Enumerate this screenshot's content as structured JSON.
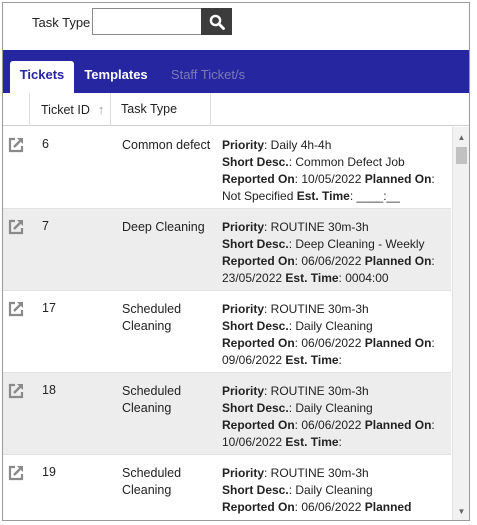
{
  "search": {
    "label": "Task Type",
    "value": "",
    "placeholder": ""
  },
  "tabs": [
    {
      "label": "Tickets",
      "state": "active"
    },
    {
      "label": "Templates",
      "state": "normal"
    },
    {
      "label": "Staff Ticket/s",
      "state": "disabled"
    }
  ],
  "table": {
    "columns": {
      "ticket_id": "Ticket ID",
      "task_type": "Task Type"
    },
    "sort_indicator": "↑",
    "rows": [
      {
        "id": "6",
        "task_type": "Common defect",
        "priority_label": "Priority",
        "priority": ": Daily 4h-4h",
        "short_desc_label": "Short Desc.",
        "short_desc": ": Common Defect Job",
        "reported_label": "Reported On",
        "reported": ": 10/05/2022 ",
        "planned_label": "Planned On",
        "planned": ": Not Specified ",
        "est_label": "Est. Time",
        "est": ": ____:__"
      },
      {
        "id": "7",
        "task_type": "Deep Cleaning",
        "priority_label": "Priority",
        "priority": ": ROUTINE 30m-3h",
        "short_desc_label": "Short Desc.",
        "short_desc": ": Deep Cleaning - Weekly",
        "reported_label": "Reported On",
        "reported": ": 06/06/2022 ",
        "planned_label": "Planned On",
        "planned": ": 23/05/2022 ",
        "est_label": "Est. Time",
        "est": ": 0004:00"
      },
      {
        "id": "17",
        "task_type": "Scheduled Cleaning",
        "priority_label": "Priority",
        "priority": ": ROUTINE 30m-3h",
        "short_desc_label": "Short Desc.",
        "short_desc": ": Daily Cleaning",
        "reported_label": "Reported On",
        "reported": ": 06/06/2022 ",
        "planned_label": "Planned On",
        "planned": ": 09/06/2022 ",
        "est_label": "Est. Time",
        "est": ":"
      },
      {
        "id": "18",
        "task_type": "Scheduled Cleaning",
        "priority_label": "Priority",
        "priority": ": ROUTINE 30m-3h",
        "short_desc_label": "Short Desc.",
        "short_desc": ": Daily Cleaning",
        "reported_label": "Reported On",
        "reported": ": 06/06/2022 ",
        "planned_label": "Planned On",
        "planned": ": 10/06/2022 ",
        "est_label": "Est. Time",
        "est": ":"
      },
      {
        "id": "19",
        "task_type": "Scheduled Cleaning",
        "priority_label": "Priority",
        "priority": ": ROUTINE 30m-3h",
        "short_desc_label": "Short Desc.",
        "short_desc": ": Daily Cleaning",
        "reported_label": "Reported On",
        "reported": ": 06/06/2022 ",
        "planned_label": "Planned",
        "planned": "",
        "est_label": "",
        "est": ""
      }
    ]
  },
  "icons": {
    "search": "search-icon",
    "open": "external-link-icon",
    "scroll_up": "scroll-up-arrow",
    "scroll_down": "scroll-down-arrow"
  },
  "colors": {
    "tab_bar": "#2626a0",
    "search_button": "#3c3c3c",
    "row_alt": "#ededed"
  }
}
